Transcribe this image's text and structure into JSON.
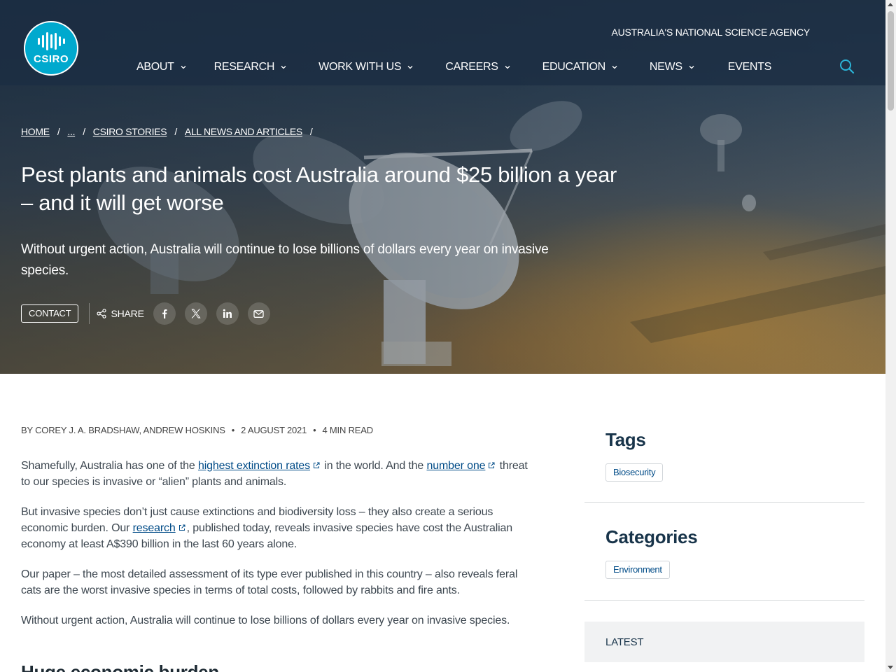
{
  "header": {
    "logo_text": "CSIRO",
    "agency": "AUSTRALIA'S NATIONAL SCIENCE AGENCY",
    "nav": [
      {
        "label": "ABOUT",
        "dropdown": true
      },
      {
        "label": "RESEARCH",
        "dropdown": true
      },
      {
        "label": "WORK WITH US",
        "dropdown": true
      },
      {
        "label": "CAREERS",
        "dropdown": true
      },
      {
        "label": "EDUCATION",
        "dropdown": true
      },
      {
        "label": "NEWS",
        "dropdown": true
      },
      {
        "label": "EVENTS",
        "dropdown": false
      }
    ],
    "search_icon": "search-icon"
  },
  "breadcrumb": [
    "HOME",
    "...",
    "CSIRO STORIES",
    "ALL NEWS AND ARTICLES"
  ],
  "hero": {
    "title": "Pest plants and animals cost Australia around $25 billion a year – and it will get worse",
    "subtitle": "Without urgent action, Australia will continue to lose billions of dollars every year on invasive species.",
    "contact_label": "CONTACT",
    "share_label": "SHARE",
    "social_icons": [
      "facebook-icon",
      "x-icon",
      "linkedin-icon",
      "email-icon"
    ]
  },
  "meta": {
    "authors": "BY COREY J. A. BRADSHAW, ANDREW HOSKINS",
    "date": "2 AUGUST 2021",
    "read_time": "4 MIN READ"
  },
  "article": {
    "p1": {
      "a": "Shamefully, Australia has one of the ",
      "link1": "highest extinction rates",
      "b": " in the world. And the ",
      "link2": "number one",
      "c": " threat to our species is invasive or “alien” plants and animals."
    },
    "p2": {
      "a": "But invasive species don’t just cause extinctions and biodiversity loss – they also create a serious economic burden. Our ",
      "link1": "research",
      "b": ", published today, reveals invasive species have cost the Australian economy at least A$390 billion in the last 60 years alone."
    },
    "p3": "Our paper – the most detailed assessment of its type ever published in this country – also reveals feral cats are the worst invasive species in terms of total costs, followed by rabbits and fire ants.",
    "p4": "Without urgent action, Australia will continue to lose billions of dollars every year on invasive species.",
    "heading": "Huge economic burden"
  },
  "sidebar": {
    "tags_title": "Tags",
    "tags": [
      "Biosecurity"
    ],
    "categories_title": "Categories",
    "categories": [
      "Environment"
    ],
    "latest_label": "LATEST"
  },
  "colors": {
    "logo": "#00a9ce",
    "link": "#004b87",
    "sidebar_heading": "#18344a",
    "latest_bg": "#f1f2f3"
  }
}
